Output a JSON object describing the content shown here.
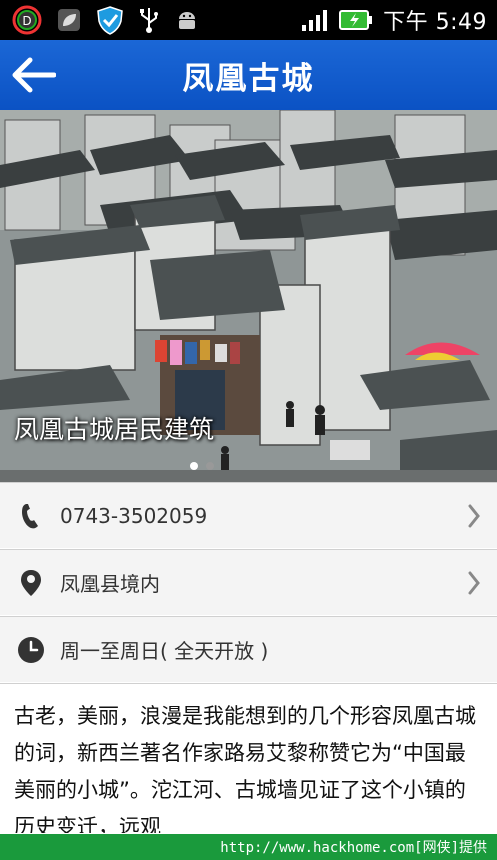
{
  "status_bar": {
    "icons": [
      "notification-d-icon",
      "leaf-icon",
      "shield-icon",
      "usb-icon",
      "android-icon",
      "signal-icon",
      "battery-icon"
    ],
    "time": "下午 5:49"
  },
  "header": {
    "title": "凤凰古城",
    "back_icon": "back-arrow-icon",
    "color": "#1560d0"
  },
  "hero": {
    "caption": "凤凰古城居民建筑",
    "pages": 2,
    "current_page": 1
  },
  "info_rows": [
    {
      "icon": "phone-icon",
      "text": "0743-3502059",
      "has_chevron": true
    },
    {
      "icon": "location-pin-icon",
      "text": "凤凰县境内",
      "has_chevron": true
    },
    {
      "icon": "clock-icon",
      "text": "周一至周日( 全天开放 )",
      "has_chevron": false
    }
  ],
  "description": "古老，美丽，浪漫是我能想到的几个形容凤凰古城的词，新西兰著名作家路易艾黎称赞它为“中国最美丽的小城”。沱江河、古城墙见证了这个小镇的历史变迁，远观",
  "footer": {
    "watermark": "http://www.hackhome.com[网侠]提供"
  }
}
